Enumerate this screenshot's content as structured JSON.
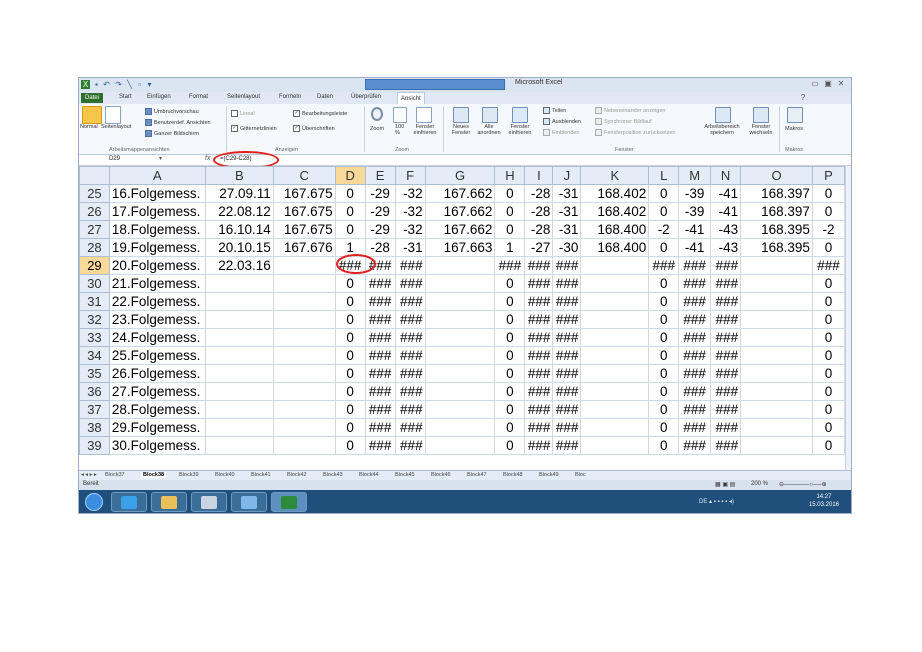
{
  "app_title": "Microsoft Excel",
  "tabs": [
    "Datei",
    "Start",
    "Einfügen",
    "Format",
    "Seitenlayout",
    "Formeln",
    "Daten",
    "Überprüfen",
    "Ansicht"
  ],
  "active_tab": "Ansicht",
  "ribbon": {
    "normal": "Normal",
    "seitenlayout": "Seitenlayout",
    "umbruchvorschau": "Umbruchvorschau",
    "benutzerdef": "Benutzerdef. Ansichten",
    "ganzer_bildschirm": "Ganzer Bildschirm",
    "group_arbeitsmappe": "Arbeitsmappenansichten",
    "lineal": "Lineal",
    "bearbeitungsleiste": "Bearbeitungsleiste",
    "gitternetzlinien": "Gitternetzlinien",
    "ueberschriften": "Überschriften",
    "group_anzeigen": "Anzeigen",
    "zoom": "Zoom",
    "zoom100": "100 %",
    "fenster_einfrieren_sel": "Fenster einfrieren",
    "group_zoom": "Zoom",
    "neues_fenster": "Neues Fenster",
    "alle_anordnen": "Alle anordnen",
    "fenster_einfrieren": "Fenster einfrieren",
    "teilen": "Teilen",
    "ausblenden": "Ausblenden",
    "einblenden": "Einblenden",
    "nebeneinander": "Nebeneinander anzeigen",
    "synchroner": "Synchroner Bildlauf",
    "fensterposition": "Fensterposition zurücksetzen",
    "arbeitsbereich": "Arbeitsbereich speichern",
    "fenster_wechseln": "Fenster wechseln",
    "group_fenster": "Fenster",
    "makros": "Makros",
    "group_makros": "Makros"
  },
  "formula_bar": {
    "name_box": "D29",
    "fx": "fx",
    "formula": "=(C29-C28)"
  },
  "columns": [
    "A",
    "B",
    "C",
    "D",
    "E",
    "F",
    "G",
    "H",
    "I",
    "J",
    "K",
    "L",
    "M",
    "N",
    "O",
    "P"
  ],
  "selected_column": "D",
  "rows": [
    {
      "n": "25",
      "cells": [
        "16.Folgemess.",
        "27.09.11",
        "167.675",
        "0",
        "-29",
        "-32",
        "167.662",
        "0",
        "-28",
        "-31",
        "168.402",
        "0",
        "-39",
        "-41",
        "168.397",
        "0"
      ]
    },
    {
      "n": "26",
      "cells": [
        "17.Folgemess.",
        "22.08.12",
        "167.675",
        "0",
        "-29",
        "-32",
        "167.662",
        "0",
        "-28",
        "-31",
        "168.402",
        "0",
        "-39",
        "-41",
        "168.397",
        "0"
      ]
    },
    {
      "n": "27",
      "cells": [
        "18.Folgemess.",
        "16.10.14",
        "167.675",
        "0",
        "-29",
        "-32",
        "167.662",
        "0",
        "-28",
        "-31",
        "168.400",
        "-2",
        "-41",
        "-43",
        "168.395",
        "-2"
      ]
    },
    {
      "n": "28",
      "cells": [
        "19.Folgemess.",
        "20.10.15",
        "167.676",
        "1",
        "-28",
        "-31",
        "167.663",
        "1",
        "-27",
        "-30",
        "168.400",
        "0",
        "-41",
        "-43",
        "168.395",
        "0"
      ]
    },
    {
      "n": "29",
      "cells": [
        "20.Folgemess.",
        "22.03.16",
        "",
        "###",
        "###",
        "###",
        "",
        "###",
        "###",
        "###",
        "",
        "###",
        "###",
        "###",
        "",
        "###"
      ]
    },
    {
      "n": "30",
      "cells": [
        "21.Folgemess.",
        "",
        "",
        "0",
        "###",
        "###",
        "",
        "0",
        "###",
        "###",
        "",
        "0",
        "###",
        "###",
        "",
        "0"
      ]
    },
    {
      "n": "31",
      "cells": [
        "22.Folgemess.",
        "",
        "",
        "0",
        "###",
        "###",
        "",
        "0",
        "###",
        "###",
        "",
        "0",
        "###",
        "###",
        "",
        "0"
      ]
    },
    {
      "n": "32",
      "cells": [
        "23.Folgemess.",
        "",
        "",
        "0",
        "###",
        "###",
        "",
        "0",
        "###",
        "###",
        "",
        "0",
        "###",
        "###",
        "",
        "0"
      ]
    },
    {
      "n": "33",
      "cells": [
        "24.Folgemess.",
        "",
        "",
        "0",
        "###",
        "###",
        "",
        "0",
        "###",
        "###",
        "",
        "0",
        "###",
        "###",
        "",
        "0"
      ]
    },
    {
      "n": "34",
      "cells": [
        "25.Folgemess.",
        "",
        "",
        "0",
        "###",
        "###",
        "",
        "0",
        "###",
        "###",
        "",
        "0",
        "###",
        "###",
        "",
        "0"
      ]
    },
    {
      "n": "35",
      "cells": [
        "26.Folgemess.",
        "",
        "",
        "0",
        "###",
        "###",
        "",
        "0",
        "###",
        "###",
        "",
        "0",
        "###",
        "###",
        "",
        "0"
      ]
    },
    {
      "n": "36",
      "cells": [
        "27.Folgemess.",
        "",
        "",
        "0",
        "###",
        "###",
        "",
        "0",
        "###",
        "###",
        "",
        "0",
        "###",
        "###",
        "",
        "0"
      ]
    },
    {
      "n": "37",
      "cells": [
        "28.Folgemess.",
        "",
        "",
        "0",
        "###",
        "###",
        "",
        "0",
        "###",
        "###",
        "",
        "0",
        "###",
        "###",
        "",
        "0"
      ]
    },
    {
      "n": "38",
      "cells": [
        "29.Folgemess.",
        "",
        "",
        "0",
        "###",
        "###",
        "",
        "0",
        "###",
        "###",
        "",
        "0",
        "###",
        "###",
        "",
        "0"
      ]
    },
    {
      "n": "39",
      "cells": [
        "30.Folgemess.",
        "",
        "",
        "0",
        "###",
        "###",
        "",
        "0",
        "###",
        "###",
        "",
        "0",
        "###",
        "###",
        "",
        "0"
      ]
    }
  ],
  "selected_row": "29",
  "sheet_tabs": [
    "Block37",
    "Block38",
    "Block39",
    "Block40",
    "Block41",
    "Block42",
    "Block43",
    "Block44",
    "Block45",
    "Block46",
    "Block47",
    "Block48",
    "Block49",
    "Bloc"
  ],
  "active_sheet": "Block38",
  "status": {
    "mode": "Bereit",
    "zoom": "200 %"
  },
  "taskbar": {
    "lang": "DE",
    "time": "14:27",
    "date": "15.03.2016"
  }
}
